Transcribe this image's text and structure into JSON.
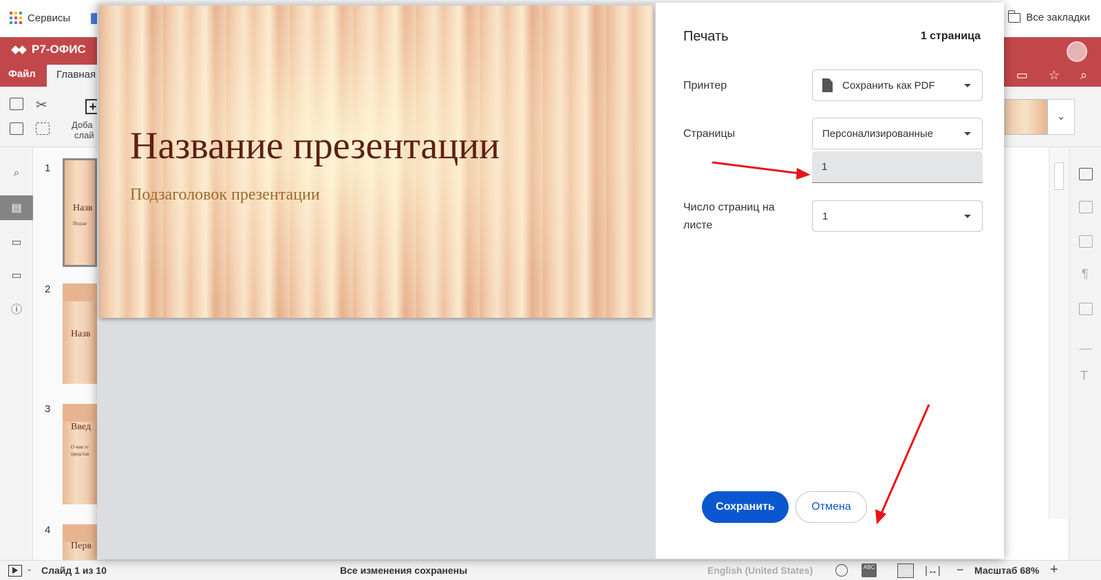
{
  "browser": {
    "services_label": "Сервисы",
    "all_bookmarks_label": "Все закладки"
  },
  "app": {
    "logo_text": "Р7-ОФИС",
    "tabs": [
      {
        "label": "Файл"
      },
      {
        "label": "Главная"
      }
    ],
    "toolbar": {
      "add_slide_label_line1": "Доба",
      "add_slide_label_line2": "слай"
    }
  },
  "slides": [
    {
      "number": "1",
      "title_snippet": "Назв",
      "sub_snippet": "Подзаг"
    },
    {
      "number": "2",
      "title_snippet": "Назв"
    },
    {
      "number": "3",
      "title_snippet": "Введ",
      "body_snippet": "О чем эт\nпредстав"
    },
    {
      "number": "4",
      "title_snippet": "Перв"
    }
  ],
  "print_dialog": {
    "title": "Печать",
    "page_count": "1 страница",
    "printer_label": "Принтер",
    "printer_value": "Сохранить как PDF",
    "pages_label": "Страницы",
    "pages_value": "Персонализированные",
    "pages_custom_value": "1",
    "pages_per_sheet_label": "Число страниц на листе",
    "pages_per_sheet_value": "1",
    "save_button": "Сохранить",
    "cancel_button": "Отмена",
    "preview_title": "Название презентации",
    "preview_subtitle": "Подзаголовок презентации"
  },
  "status_bar": {
    "slide_info": "Слайд 1 из 10",
    "saved_status": "Все изменения сохранены",
    "language": "English (United States)",
    "zoom_label": "Масштаб 68%"
  },
  "colors": {
    "header_red": "#c2474a",
    "primary_blue": "#0b57d0",
    "annotation_red": "#e8141a"
  }
}
